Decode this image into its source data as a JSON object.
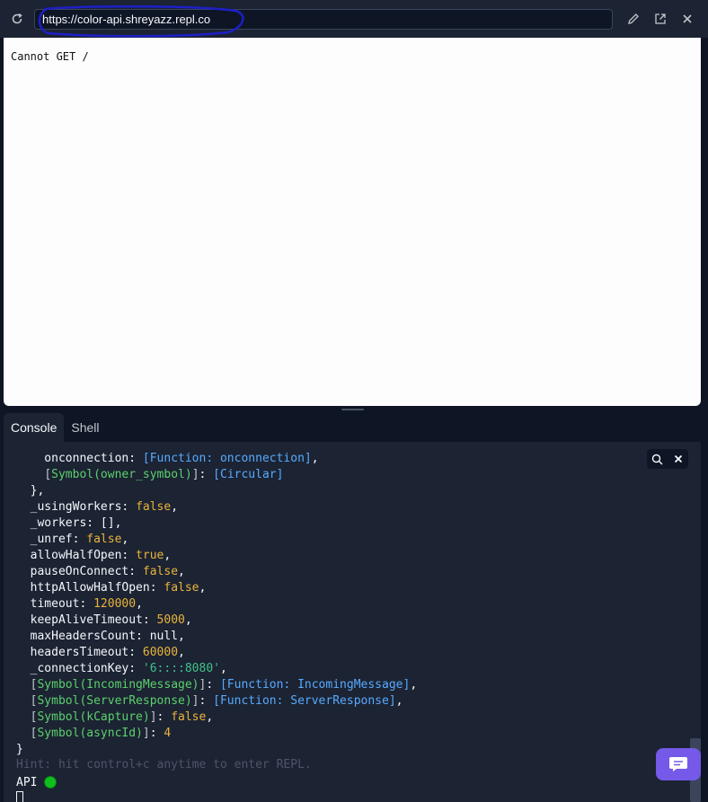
{
  "header": {
    "url": "https://color-api.shreyazz.repl.co",
    "icons": [
      "refresh-icon",
      "pencil-icon",
      "open-external-icon",
      "close-icon"
    ]
  },
  "webview": {
    "text": "Cannot GET /"
  },
  "tabs": [
    {
      "label": "Console",
      "active": true
    },
    {
      "label": "Shell",
      "active": false
    }
  ],
  "console": {
    "lines": [
      [
        {
          "t": "    onconnection: ",
          "c": ""
        },
        {
          "t": "[Function: onconnection]",
          "c": "c-fn"
        },
        {
          "t": ",",
          "c": ""
        }
      ],
      [
        {
          "t": "    ",
          "c": ""
        },
        {
          "t": "[",
          "c": "c-br"
        },
        {
          "t": "Symbol(owner_symbol)",
          "c": "c-sym"
        },
        {
          "t": "]",
          "c": "c-br"
        },
        {
          "t": ": ",
          "c": ""
        },
        {
          "t": "[Circular]",
          "c": "c-fn"
        }
      ],
      [
        {
          "t": "  },",
          "c": ""
        }
      ],
      [
        {
          "t": "  _usingWorkers: ",
          "c": ""
        },
        {
          "t": "false",
          "c": "c-bool"
        },
        {
          "t": ",",
          "c": ""
        }
      ],
      [
        {
          "t": "  _workers: [],",
          "c": ""
        }
      ],
      [
        {
          "t": "  _unref: ",
          "c": ""
        },
        {
          "t": "false",
          "c": "c-bool"
        },
        {
          "t": ",",
          "c": ""
        }
      ],
      [
        {
          "t": "  allowHalfOpen: ",
          "c": ""
        },
        {
          "t": "true",
          "c": "c-bool"
        },
        {
          "t": ",",
          "c": ""
        }
      ],
      [
        {
          "t": "  pauseOnConnect: ",
          "c": ""
        },
        {
          "t": "false",
          "c": "c-bool"
        },
        {
          "t": ",",
          "c": ""
        }
      ],
      [
        {
          "t": "  httpAllowHalfOpen: ",
          "c": ""
        },
        {
          "t": "false",
          "c": "c-bool"
        },
        {
          "t": ",",
          "c": ""
        }
      ],
      [
        {
          "t": "  timeout: ",
          "c": ""
        },
        {
          "t": "120000",
          "c": "c-num"
        },
        {
          "t": ",",
          "c": ""
        }
      ],
      [
        {
          "t": "  keepAliveTimeout: ",
          "c": ""
        },
        {
          "t": "5000",
          "c": "c-num"
        },
        {
          "t": ",",
          "c": ""
        }
      ],
      [
        {
          "t": "  maxHeadersCount: null,",
          "c": ""
        }
      ],
      [
        {
          "t": "  headersTimeout: ",
          "c": ""
        },
        {
          "t": "60000",
          "c": "c-num"
        },
        {
          "t": ",",
          "c": ""
        }
      ],
      [
        {
          "t": "  _connectionKey: ",
          "c": ""
        },
        {
          "t": "'6::::8080'",
          "c": "c-str"
        },
        {
          "t": ",",
          "c": ""
        }
      ],
      [
        {
          "t": "  ",
          "c": ""
        },
        {
          "t": "[",
          "c": "c-br"
        },
        {
          "t": "Symbol(IncomingMessage)",
          "c": "c-sym"
        },
        {
          "t": "]",
          "c": "c-br"
        },
        {
          "t": ": ",
          "c": ""
        },
        {
          "t": "[Function: IncomingMessage]",
          "c": "c-fn"
        },
        {
          "t": ",",
          "c": ""
        }
      ],
      [
        {
          "t": "  ",
          "c": ""
        },
        {
          "t": "[",
          "c": "c-br"
        },
        {
          "t": "Symbol(ServerResponse)",
          "c": "c-sym"
        },
        {
          "t": "]",
          "c": "c-br"
        },
        {
          "t": ": ",
          "c": ""
        },
        {
          "t": "[Function: ServerResponse]",
          "c": "c-fn"
        },
        {
          "t": ",",
          "c": ""
        }
      ],
      [
        {
          "t": "  ",
          "c": ""
        },
        {
          "t": "[",
          "c": "c-br"
        },
        {
          "t": "Symbol(kCapture)",
          "c": "c-sym"
        },
        {
          "t": "]",
          "c": "c-br"
        },
        {
          "t": ": ",
          "c": ""
        },
        {
          "t": "false",
          "c": "c-bool"
        },
        {
          "t": ",",
          "c": ""
        }
      ],
      [
        {
          "t": "  ",
          "c": ""
        },
        {
          "t": "[",
          "c": "c-br"
        },
        {
          "t": "Symbol(asyncId)",
          "c": "c-sym"
        },
        {
          "t": "]",
          "c": "c-br"
        },
        {
          "t": ": ",
          "c": ""
        },
        {
          "t": "4",
          "c": "c-num"
        }
      ],
      [
        {
          "t": "}",
          "c": ""
        }
      ]
    ],
    "hint": "Hint: hit control+c anytime to enter REPL.",
    "status_label": "API",
    "status_color": "#0fbf1d",
    "tools": [
      "search-icon",
      "close-icon"
    ]
  },
  "chat_button": {
    "icon": "chat-icon",
    "color": "#7559e8"
  }
}
